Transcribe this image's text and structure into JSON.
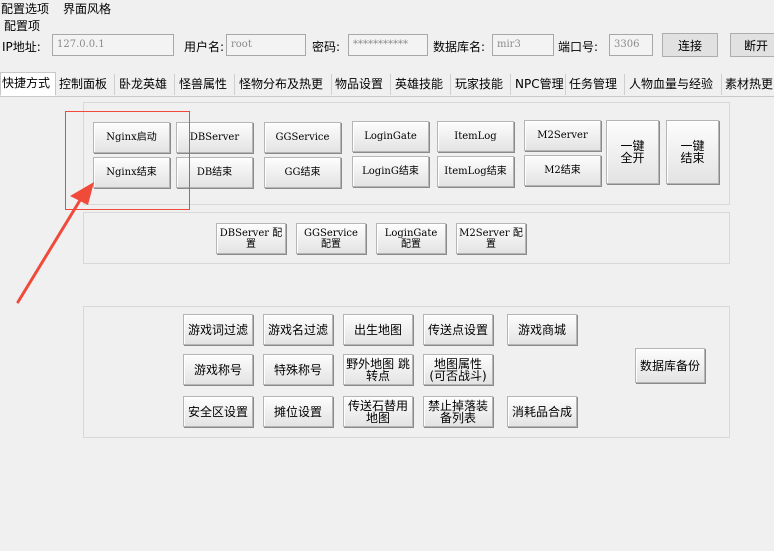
{
  "menu": {
    "config": "配置选项",
    "theme": "界面风格"
  },
  "group_title": "配置项",
  "connection": {
    "ip_label": "IP地址:",
    "ip_value": "127.0.0.1",
    "user_label": "用户名:",
    "user_value": "root",
    "pwd_label": "密码:",
    "pwd_value": "***********",
    "db_label": "数据库名:",
    "db_value": "mir3",
    "port_label": "端口号:",
    "port_value": "3306",
    "connect_btn": "连接",
    "disconnect_btn": "断开"
  },
  "tabs": [
    "快捷方式",
    "控制面板",
    "卧龙英雄",
    "怪兽属性",
    "怪物分布及热更",
    "物品设置",
    "英雄技能",
    "玩家技能",
    "NPC管理",
    "任务管理",
    "人物血量与经验",
    "素材热更"
  ],
  "server_buttons": {
    "nginx_start": "Nginx启动",
    "nginx_stop": "Nginx结束",
    "db_server": "DBServer",
    "db_stop": "DB结束",
    "gg_service": "GGService",
    "gg_stop": "GG结束",
    "login_gate": "LoginGate",
    "login_g_stop": "LoginG结束",
    "item_log": "ItemLog",
    "item_log_stop": "ItemLog结束",
    "m2_server": "M2Server",
    "m2_stop": "M2结束",
    "all_start": "一键\n全开",
    "all_stop": "一键\n结束"
  },
  "config_buttons": {
    "db_config": "DBServer 配\n置",
    "gg_config": "GGService\n配置",
    "login_config": "LoginGate\n配置",
    "m2_config": "M2Server 配\n置"
  },
  "tool_buttons": {
    "word_filter": "游戏词过滤",
    "name_filter": "游戏名过滤",
    "birth_map": "出生地图",
    "teleport_set": "传送点设置",
    "shop": "游戏商城",
    "title": "游戏称号",
    "special_title": "特殊称号",
    "wild_map": "野外地图 跳\n转点",
    "map_attr": "地图属性\n(可否战斗)",
    "db_backup": "数据库备份",
    "safe_zone": "安全区设置",
    "stall": "摊位设置",
    "stone_map": "传送石替用\n地图",
    "ban_drop": "禁止掉落装\n备列表",
    "consumable": "消耗品合成"
  },
  "colors": {
    "annotation": "#f04a3a"
  }
}
